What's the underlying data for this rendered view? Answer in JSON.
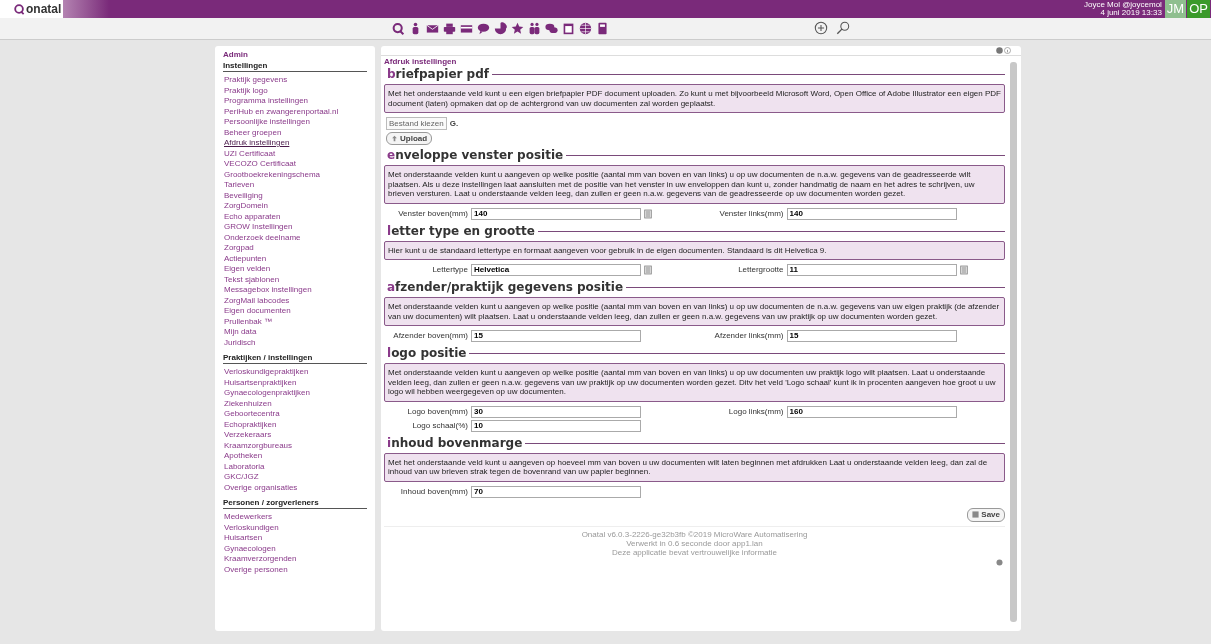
{
  "top_bar": {
    "logo": "onatal",
    "user": "Joyce Mol @joycemol",
    "datetime": "4 juni 2019 13:33",
    "badges": [
      {
        "label": "JM",
        "color": "#8fbf8f"
      },
      {
        "label": "OP",
        "color": "#3a9a2a"
      }
    ]
  },
  "sidebar": {
    "title": "Admin",
    "groups": [
      {
        "title": "Instellingen",
        "items": [
          {
            "label": "Praktijk gegevens",
            "selected": false
          },
          {
            "label": "Praktijk logo",
            "selected": false
          },
          {
            "label": "Programma instellingen",
            "selected": false
          },
          {
            "label": "PeriHub en zwangerenportaal.nl",
            "selected": false
          },
          {
            "label": "Persoonlijke instellingen",
            "selected": false
          },
          {
            "label": "Beheer groepen",
            "selected": false
          },
          {
            "label": "Afdruk instellingen",
            "selected": true
          },
          {
            "label": "UZI Certificaat",
            "selected": false
          },
          {
            "label": "VECOZO Certificaat",
            "selected": false
          },
          {
            "label": "Grootboekrekeningschema",
            "selected": false
          },
          {
            "label": "Tarieven",
            "selected": false
          },
          {
            "label": "Beveiliging",
            "selected": false
          },
          {
            "label": "ZorgDomein",
            "selected": false
          },
          {
            "label": "Echo apparaten",
            "selected": false
          },
          {
            "label": "GROW Instellingen",
            "selected": false
          },
          {
            "label": "Onderzoek deelname",
            "selected": false
          },
          {
            "label": "Zorgpad",
            "selected": false
          },
          {
            "label": "Actiepunten",
            "selected": false
          },
          {
            "label": "Eigen velden",
            "selected": false
          },
          {
            "label": "Tekst sjablonen",
            "selected": false
          },
          {
            "label": "Messagebox instellingen",
            "selected": false
          },
          {
            "label": "ZorgMail labcodes",
            "selected": false
          },
          {
            "label": "Eigen documenten",
            "selected": false
          },
          {
            "label": "Prullenbak ™",
            "selected": false
          },
          {
            "label": "Mijn data",
            "selected": false
          },
          {
            "label": "Juridisch",
            "selected": false
          }
        ]
      },
      {
        "title": "Praktijken / instellingen",
        "items": [
          {
            "label": "Verloskundigepraktijken",
            "selected": false
          },
          {
            "label": "Huisartsenpraktijken",
            "selected": false
          },
          {
            "label": "Gynaecologenpraktijken",
            "selected": false
          },
          {
            "label": "Ziekenhuizen",
            "selected": false
          },
          {
            "label": "Geboortecentra",
            "selected": false
          },
          {
            "label": "Echopraktijken",
            "selected": false
          },
          {
            "label": "Verzekeraars",
            "selected": false
          },
          {
            "label": "Kraamzorgbureaus",
            "selected": false
          },
          {
            "label": "Apotheken",
            "selected": false
          },
          {
            "label": "Laboratoria",
            "selected": false
          },
          {
            "label": "GKC/JGZ",
            "selected": false
          },
          {
            "label": "Overige organisaties",
            "selected": false
          }
        ]
      },
      {
        "title": "Personen / zorgverleners",
        "items": [
          {
            "label": "Medewerkers",
            "selected": false
          },
          {
            "label": "Verloskundigen",
            "selected": false
          },
          {
            "label": "Huisartsen",
            "selected": false
          },
          {
            "label": "Gynaecologen",
            "selected": false
          },
          {
            "label": "Kraamverzorgenden",
            "selected": false
          },
          {
            "label": "Overige personen",
            "selected": false
          }
        ]
      }
    ]
  },
  "main": {
    "breadcrumb": "Afdruk instellingen",
    "sections": [
      {
        "title": "briefpapier pdf",
        "description": "Met het onderstaande veld kunt u een eigen briefpapier PDF document uploaden. Zo kunt u met bijvoorbeeld Microsoft Word, Open Office of Adobe Illustrator een eigen PDF document (laten) opmaken dat op de achtergrond van uw documenten zal worden geplaatst.",
        "upload": {
          "file_button": "Bestand kiezen",
          "file_status": "G.",
          "button": "Upload"
        }
      },
      {
        "title": "enveloppe venster positie",
        "description": "Met onderstaande velden kunt u aangeven op welke positie (aantal mm van boven en van links) u op uw documenten de n.a.w. gegevens van de geadresseerde wilt plaatsen. Als u deze instellingen laat aansluiten met de positie van het venster in uw enveloppen dan kunt u, zonder handmatig de naam en het adres te schrijven, uw brieven versturen. Laat u onderstaande velden leeg, dan zullen er geen n.a.w. gegevens van de geadresseerde op uw documenten worden gezet.",
        "fields": [
          {
            "label": "Venster boven(mm)",
            "value": "140",
            "picker": true
          },
          {
            "label": "Venster links(mm)",
            "value": "140",
            "picker": false
          }
        ]
      },
      {
        "title": "letter type en grootte",
        "description": "Hier kunt u de standaard lettertype en formaat aangeven voor gebruik in de eigen documenten. Standaard is dit Helvetica 9.",
        "fields": [
          {
            "label": "Lettertype",
            "value": "Helvetica",
            "picker": true
          },
          {
            "label": "Lettergrootte",
            "value": "11",
            "picker": true
          }
        ]
      },
      {
        "title": "afzender/praktijk gegevens positie",
        "description": "Met onderstaande velden kunt u aangeven op welke positie (aantal mm van boven en van links) u op uw documenten de n.a.w. gegevens van uw eigen praktijk (de afzender van uw documenten) wilt plaatsen. Laat u onderstaande velden leeg, dan zullen er geen n.a.w. gegevens van uw praktijk op uw documenten worden gezet.",
        "fields": [
          {
            "label": "Afzender boven(mm)",
            "value": "15",
            "picker": false
          },
          {
            "label": "Afzender links(mm)",
            "value": "15",
            "picker": false
          }
        ]
      },
      {
        "title": "logo positie",
        "description": "Met onderstaande velden kunt u aangeven op welke positie (aantal mm van boven en van links) u op uw documenten uw praktijk logo wilt plaatsen. Laat u onderstaande velden leeg, dan zullen er geen n.a.w. gegevens van uw praktijk op uw documenten worden gezet. Ditv het veld 'Logo schaal' kunt ik in procenten aangeven hoe groot u uw logo wil hebben weergegeven op uw documenten.",
        "fields": [
          {
            "label": "Logo boven(mm)",
            "value": "30",
            "picker": false
          },
          {
            "label": "Logo links(mm)",
            "value": "160",
            "picker": false
          },
          {
            "label": "Logo schaal(%)",
            "value": "10",
            "picker": false
          }
        ]
      },
      {
        "title": "inhoud bovenmarge",
        "description": "Met het onderstaande veld kunt u aangeven op hoeveel mm van boven u uw documenten wilt laten beginnen met afdrukken Laat u onderstaande velden leeg, dan zal de inhoud van uw brieven strak tegen de bovenrand van uw papier beginnen.",
        "fields": [
          {
            "label": "Inhoud boven(mm)",
            "value": "70",
            "picker": false
          }
        ]
      }
    ],
    "save_button": "Save",
    "footer": [
      "Onatal v6.0.3-2226-ge32b3fb ©2019 MicroWare Automatisering",
      "Verwerkt in 0.6 seconde door app1.lan",
      "Deze applicatie bevat vertrouwelijke informatie"
    ]
  }
}
